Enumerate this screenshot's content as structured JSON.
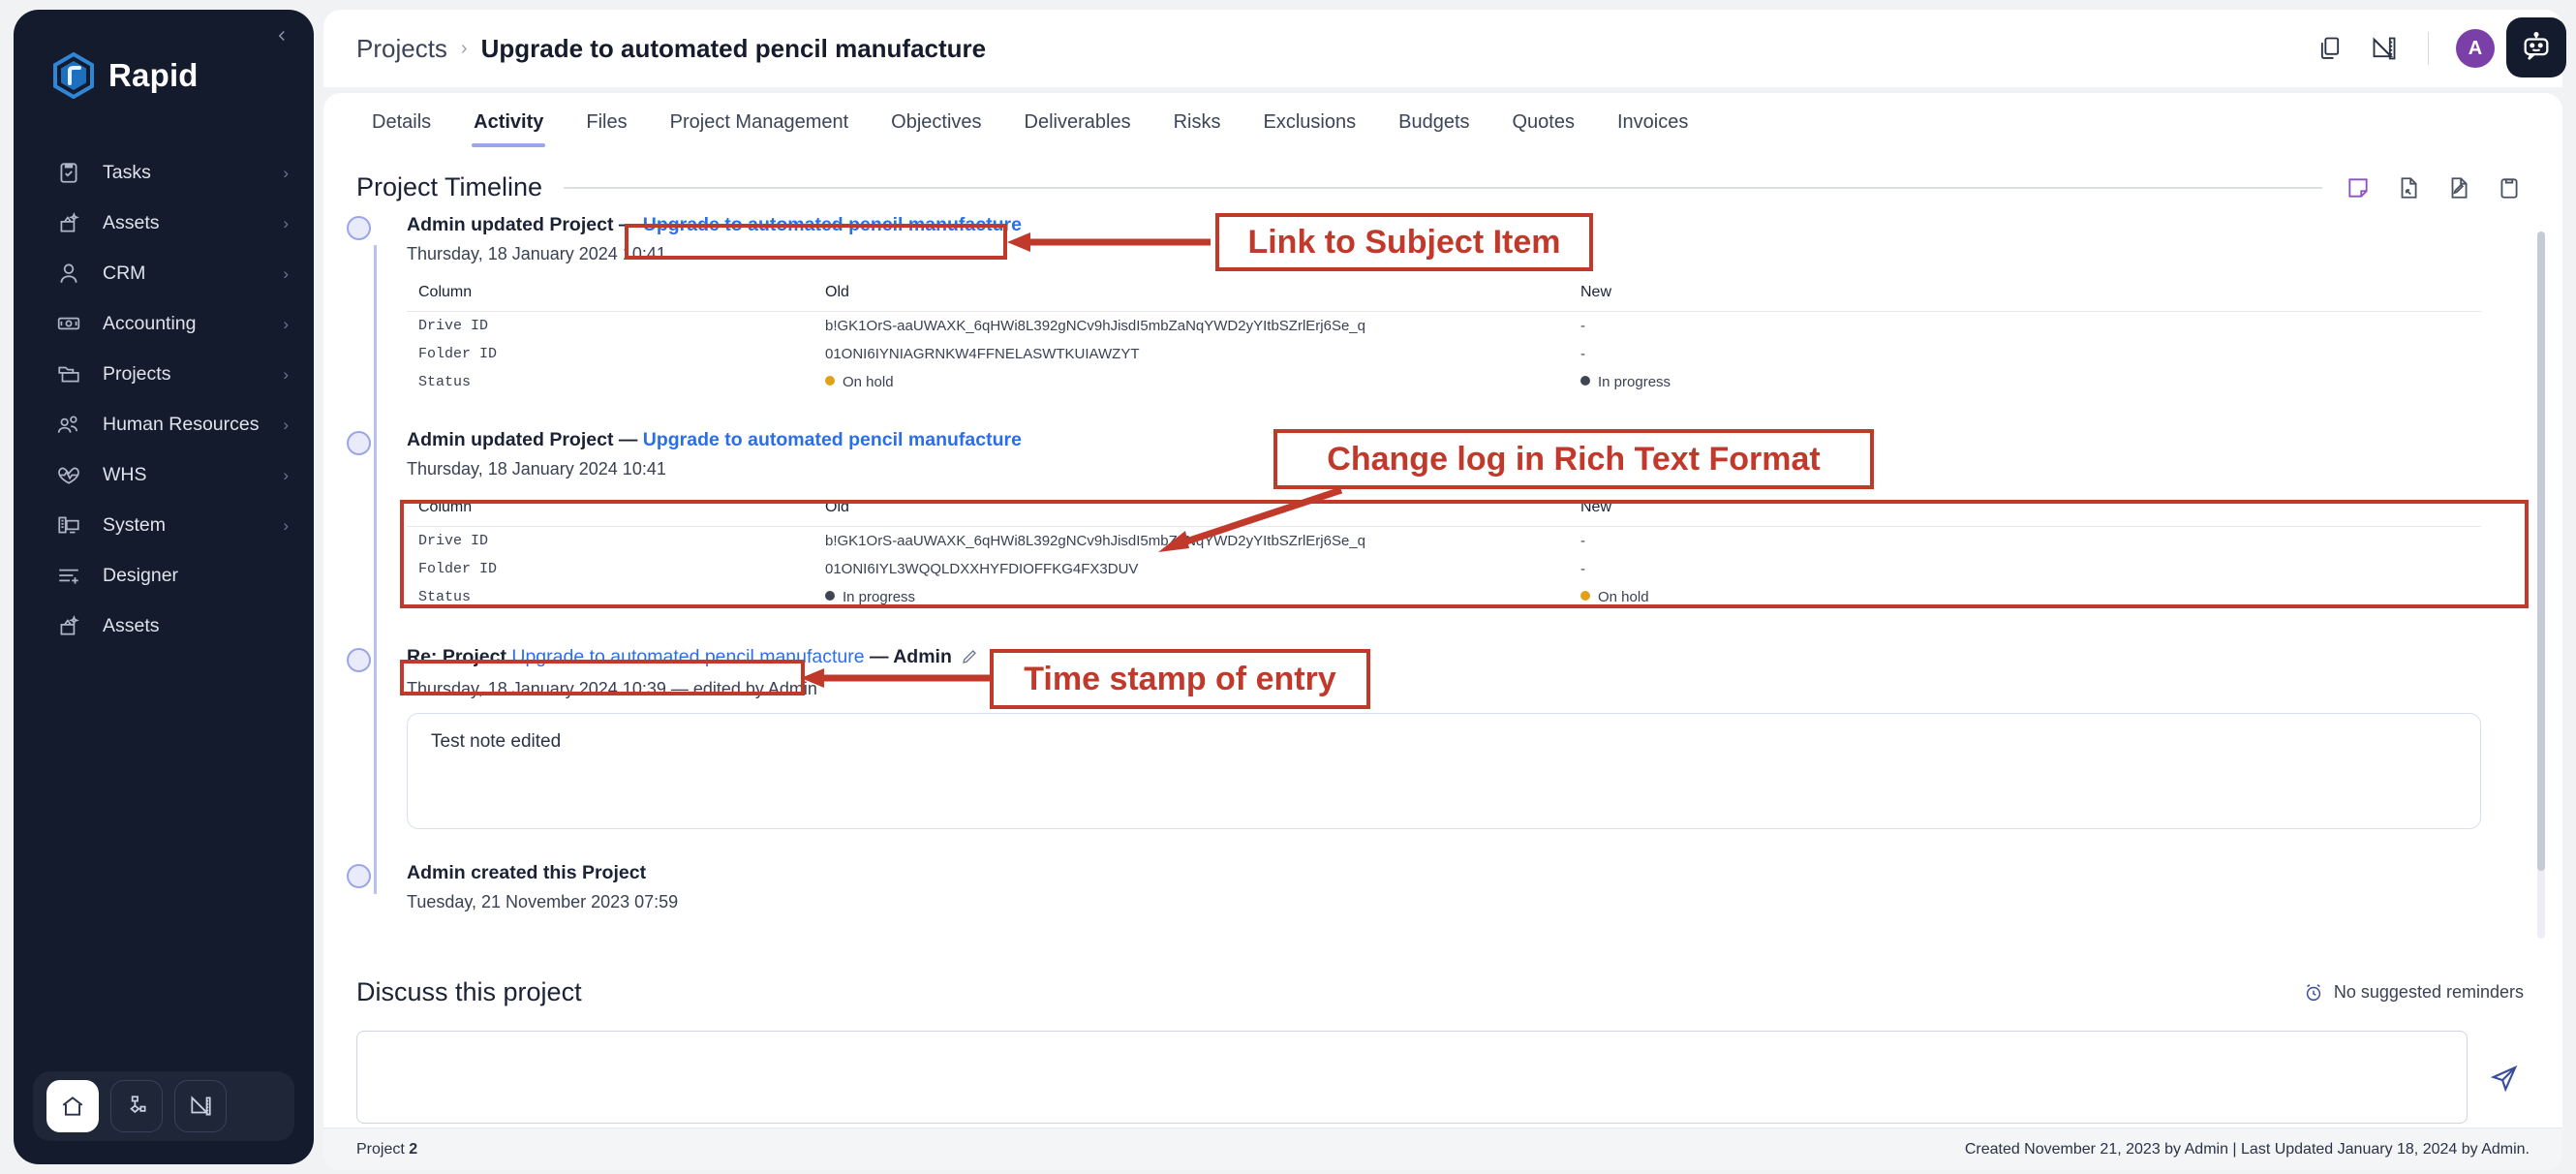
{
  "sidebar": {
    "brand": "Rapid",
    "collapse_icon": "chevron-left-icon",
    "items": [
      {
        "label": "Tasks",
        "icon": "clipboard-check-icon",
        "arrow": "chevron-right-icon",
        "has_arrow": true
      },
      {
        "label": "Assets",
        "icon": "assets-sparkle-icon",
        "arrow": "chevron-right-icon",
        "has_arrow": true
      },
      {
        "label": "CRM",
        "icon": "user-icon",
        "arrow": "chevron-right-icon",
        "has_arrow": true
      },
      {
        "label": "Accounting",
        "icon": "banknote-icon",
        "arrow": "chevron-right-icon",
        "has_arrow": true
      },
      {
        "label": "Projects",
        "icon": "folder-icon",
        "arrow": "chevron-right-icon",
        "has_arrow": true
      },
      {
        "label": "Human Resources",
        "icon": "users-icon",
        "arrow": "chevron-right-icon",
        "has_arrow": true
      },
      {
        "label": "WHS",
        "icon": "heartbeat-icon",
        "arrow": "chevron-right-icon",
        "has_arrow": true
      },
      {
        "label": "System",
        "icon": "server-monitor-icon",
        "arrow": "chevron-right-icon",
        "has_arrow": true
      },
      {
        "label": "Designer",
        "icon": "list-plus-icon",
        "arrow": "",
        "has_arrow": false
      },
      {
        "label": "Assets",
        "icon": "assets-sparkle-icon",
        "arrow": "",
        "has_arrow": false
      }
    ],
    "bottom_buttons": [
      {
        "name": "home-icon",
        "active": true
      },
      {
        "name": "workflow-icon",
        "active": false
      },
      {
        "name": "ruler-icon",
        "active": false
      }
    ]
  },
  "topbar": {
    "breadcrumb_root": "Projects",
    "breadcrumb_sep": "›",
    "title": "Upgrade to automated pencil manufacture",
    "actions": [
      {
        "name": "copy-icon"
      },
      {
        "name": "ruler-pen-icon"
      }
    ],
    "avatar_initial": "A",
    "avatar_color": "#7b3fa8",
    "chevron": "chevron-down-icon",
    "assistant_icon": "robot-chat-icon"
  },
  "tabs": [
    {
      "label": "Details",
      "active": false
    },
    {
      "label": "Activity",
      "active": true
    },
    {
      "label": "Files",
      "active": false
    },
    {
      "label": "Project Management",
      "active": false
    },
    {
      "label": "Objectives",
      "active": false
    },
    {
      "label": "Deliverables",
      "active": false
    },
    {
      "label": "Risks",
      "active": false
    },
    {
      "label": "Exclusions",
      "active": false
    },
    {
      "label": "Budgets",
      "active": false
    },
    {
      "label": "Quotes",
      "active": false
    },
    {
      "label": "Invoices",
      "active": false
    }
  ],
  "timeline": {
    "section_title": "Project Timeline",
    "section_icons": [
      {
        "name": "sticky-note-icon",
        "color": "#8b4fc9"
      },
      {
        "name": "document-add-icon",
        "color": "#4b5260"
      },
      {
        "name": "document-edit-icon",
        "color": "#4b5260"
      },
      {
        "name": "clipboard-icon",
        "color": "#4b5260"
      }
    ],
    "table_headers": {
      "column": "Column",
      "old": "Old",
      "new": "New"
    },
    "status_colors": {
      "on_hold": "#e0a117",
      "in_progress": "#3f4553"
    },
    "entries": [
      {
        "type": "change",
        "title_prefix": "Admin updated Project —",
        "subject": "Upgrade to automated pencil manufacture",
        "date": "Thursday, 18 January 2024 10:41",
        "rows": [
          {
            "column": "Drive ID",
            "old": "b!GK1OrS-aaUWAXK_6qHWi8L392gNCv9hJisdI5mbZaNqYWD2yYItbSZrlErj6Se_q",
            "new": "-",
            "old_status": "",
            "new_status": ""
          },
          {
            "column": "Folder ID",
            "old": "01ONI6IYNIAGRNKW4FFNELASWTKUIAWZYT",
            "new": "-",
            "old_status": "",
            "new_status": ""
          },
          {
            "column": "Status",
            "old": "On hold",
            "new": "In progress",
            "old_status": "on_hold",
            "new_status": "in_progress"
          }
        ]
      },
      {
        "type": "change",
        "title_prefix": "Admin updated Project —",
        "subject": "Upgrade to automated pencil manufacture",
        "date": "Thursday, 18 January 2024 10:41",
        "rows": [
          {
            "column": "Drive ID",
            "old": "b!GK1OrS-aaUWAXK_6qHWi8L392gNCv9hJisdI5mbZaNqYWD2yYItbSZrlErj6Se_q",
            "new": "-",
            "old_status": "",
            "new_status": ""
          },
          {
            "column": "Folder ID",
            "old": "01ONI6IYL3WQQLDXXHYFDIOFFKG4FX3DUV",
            "new": "-",
            "old_status": "",
            "new_status": ""
          },
          {
            "column": "Status",
            "old": "In progress",
            "new": "On hold",
            "old_status": "in_progress",
            "new_status": "on_hold"
          }
        ]
      },
      {
        "type": "note",
        "title_prefix": "Re: Project",
        "subject": "Upgrade to automated pencil manufacture",
        "title_suffix": "— Admin",
        "edit_icon": "pencil-icon",
        "date": "Thursday, 18 January 2024 10:39 — edited by Admin",
        "body": "Test note edited"
      },
      {
        "type": "created",
        "title_prefix": "Admin created this Project",
        "date": "Tuesday, 21 November 2023 07:59"
      }
    ]
  },
  "discuss": {
    "title": "Discuss this project",
    "reminder_icon": "alarm-clock-icon",
    "reminder_text": "No suggested reminders",
    "input_value": "",
    "input_placeholder": "",
    "send_icon": "send-icon"
  },
  "footer": {
    "left_label": "Project",
    "left_value": "2",
    "right": "Created November 21, 2023 by Admin | Last Updated January 18, 2024 by Admin."
  },
  "annotations": [
    {
      "text": "Link to Subject Item",
      "color": "#c0392b"
    },
    {
      "text": "Change log in Rich Text Format",
      "color": "#c0392b"
    },
    {
      "text": "Time stamp of entry",
      "color": "#c0392b"
    }
  ]
}
